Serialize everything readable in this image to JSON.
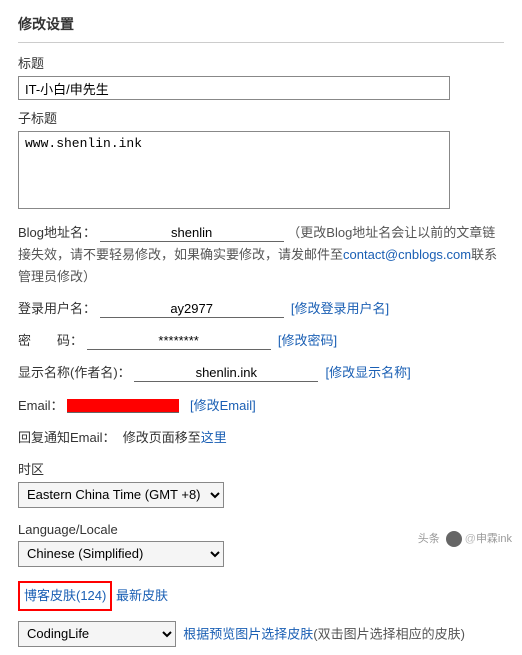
{
  "page_title": "修改设置",
  "title": {
    "label": "标题",
    "value": "IT-小白/申先生"
  },
  "subtitle": {
    "label": "子标题",
    "value": "www.shenlin.ink"
  },
  "blog_url": {
    "label_prefix": "Blog地址名：",
    "value": "shenlin",
    "hint": "（更改Blog地址名会让以前的文章链接失效，请不要轻易修改，如果确实要修改，请发邮件至",
    "contact": "contact@cnblogs.com",
    "hint_suffix": "联系管理员修改）"
  },
  "login_user": {
    "label": "登录用户名：",
    "value": "ay2977",
    "link": "[修改登录用户名]"
  },
  "password": {
    "label": "密　　码：",
    "value": "********",
    "link": "[修改密码]"
  },
  "display_name": {
    "label": "显示名称(作者名)：",
    "value": "shenlin.ink",
    "link": "[修改显示名称]"
  },
  "email": {
    "label": "Email：",
    "link": "[修改Email]"
  },
  "reply_email": {
    "label": "回复通知Email：",
    "hint": "修改页面移至",
    "link": "这里"
  },
  "timezone": {
    "label": "时区",
    "value": "Eastern China Time (GMT +8)"
  },
  "locale": {
    "label": "Language/Locale",
    "value": "Chinese (Simplified)"
  },
  "skin": {
    "label": "博客皮肤(124)",
    "link": "最新皮肤",
    "value": "CodingLife",
    "hint_link": "根据预览图片选择皮肤",
    "hint_suffix": "(双击图片选择相应的皮肤)"
  },
  "footer": {
    "prefix": "头条",
    "at": "@",
    "name": "申霖ink"
  }
}
